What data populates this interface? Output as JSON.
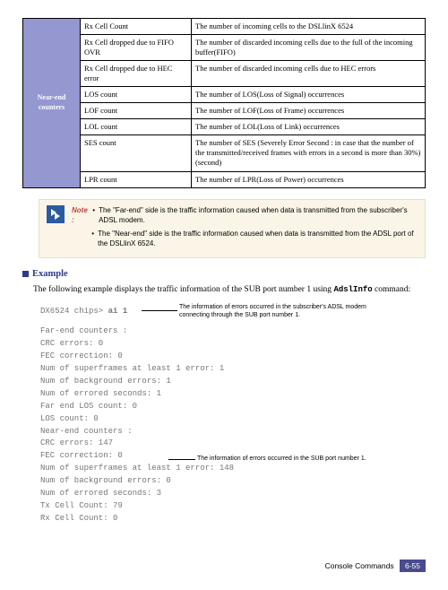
{
  "table": {
    "group_label": "Near-end counters",
    "rows": [
      {
        "name": "Rx Cell Count",
        "desc": "The number of incoming cells to the DSLlinX 6524"
      },
      {
        "name": "Rx Cell dropped due to FIFO OVR",
        "desc": "The number of discarded incoming cells due to the full of the incoming buffer(FIFO)"
      },
      {
        "name": "Rx Cell dropped due to HEC error",
        "desc": "The number of discarded incoming cells due to HEC errors"
      },
      {
        "name": "LOS count",
        "desc": "The number of LOS(Loss of Signal) occurrences"
      },
      {
        "name": "LOF count",
        "desc": "The number of LOF(Loss of Frame) occurrences"
      },
      {
        "name": "LOL count",
        "desc": "The number of LOL(Loss of Link) occurrences"
      },
      {
        "name": "SES count",
        "desc": "The number of SES (Severely Error Second : in case that the number of the transmitted/received frames with errors in a second is more than 30%) (second)"
      },
      {
        "name": "LPR count",
        "desc": "The number of LPR(Loss of Power) occurrences"
      }
    ]
  },
  "note": {
    "label": "Note :",
    "items": [
      "The \"Far-end\" side is the traffic information caused when data is transmitted from the subscriber's ADSL modem.",
      "The \"Near-end\" side is the traffic information caused when data is transmitted from the ADSL port of the DSLlinX 6524."
    ]
  },
  "example": {
    "heading": "Example",
    "intro": "The following example displays the traffic information of the SUB port number 1 using",
    "cmd_name": "AdslInfo",
    "intro_tail": " command:",
    "callout1_l1": "The information of errors occurred in the subscriber's ADSL modem",
    "callout1_l2": "connecting through the SUB port number 1.",
    "callout2": "The information of errors occurred in the SUB port number 1.",
    "terminal": {
      "prompt": "DX6524 chips>",
      "input_cmd": "ai 1",
      "lines": [
        "Far-end counters :",
        "CRC errors: 0",
        "  FEC correction: 0",
        "  Num of superframes at least 1 error: 1",
        "  Num of background errors: 1",
        "  Num of errored seconds: 1",
        "  Far end LOS count: 0",
        "  LOS count: 0",
        "Near-end counters :",
        "  CRC errors: 147",
        "  FEC correction: 0",
        "  Num of superframes at least 1 error: 148",
        "  Num of background errors: 0",
        "  Num of errored seconds: 3",
        "  Tx Cell Count: 79",
        "  Rx Cell Count: 0"
      ]
    }
  },
  "footer": {
    "section": "Console Commands",
    "page": "6-55"
  }
}
